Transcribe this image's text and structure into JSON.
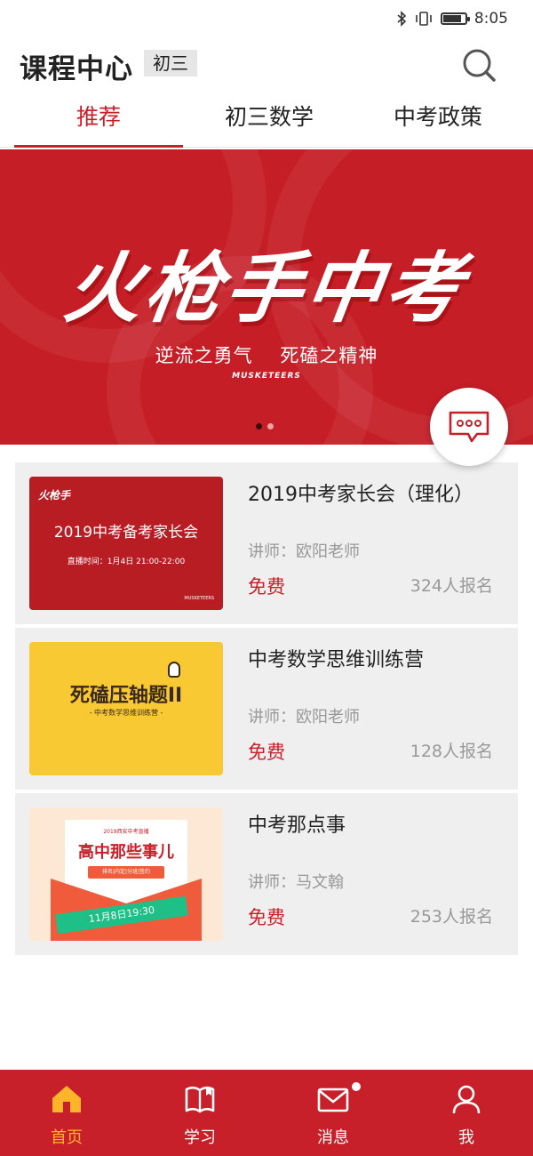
{
  "status_bar": {
    "time": "8:05",
    "battery_level": 0.85
  },
  "header": {
    "title": "课程中心",
    "grade": "初三",
    "search_icon": "search-icon"
  },
  "tabs": [
    {
      "label": "推荐",
      "active": true
    },
    {
      "label": "初三数学",
      "active": false
    },
    {
      "label": "中考政策",
      "active": false
    }
  ],
  "banner": {
    "title": "火枪手中考",
    "slogan": "逆流之勇气    死磕之精神",
    "brand": "MUSKETEERS",
    "slide_count": 2,
    "current_slide": 1
  },
  "chat_button_icon": "chat-bubble-icon",
  "courses": [
    {
      "title": "2019中考家长会（理化）",
      "teacher": "讲师：欧阳老师",
      "price": "免费",
      "enroll": "324人报名",
      "thumb": {
        "logo": "火枪手",
        "headline": "2019中考备考家长会",
        "sub": "直播时间：1月4日  21:00-22:00",
        "mark": "MUSKETEERS"
      }
    },
    {
      "title": "中考数学思维训练营",
      "teacher": "讲师：欧阳老师",
      "price": "免费",
      "enroll": "128人报名",
      "thumb": {
        "headline": "死磕压轴题II",
        "sub": "- 中考数学思维训练营 -"
      }
    },
    {
      "title": "中考那点事",
      "teacher": "讲师：马文翰",
      "price": "免费",
      "enroll": "253人报名",
      "thumb": {
        "sub": "2019西安中考直播",
        "headline": "高中那些事儿",
        "tags": "排名|内定|分班|签约",
        "date": "11月8日19:30"
      }
    }
  ],
  "bottom_nav": [
    {
      "label": "首页",
      "icon": "home-icon",
      "active": true
    },
    {
      "label": "学习",
      "icon": "book-icon",
      "active": false
    },
    {
      "label": "消息",
      "icon": "mail-icon",
      "active": false,
      "has_badge": true
    },
    {
      "label": "我",
      "icon": "user-icon",
      "active": false
    }
  ],
  "colors": {
    "brand_red": "#c8202a",
    "active_nav": "#ffb42a",
    "thumb_yellow": "#f8c932"
  }
}
